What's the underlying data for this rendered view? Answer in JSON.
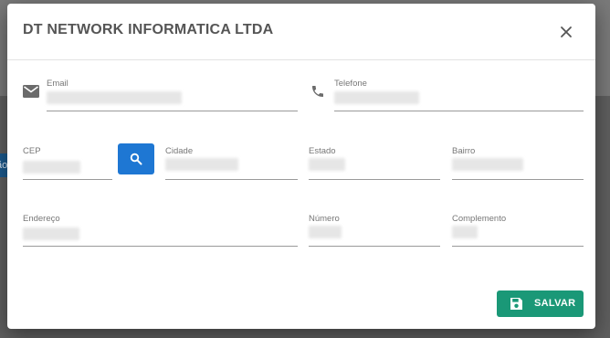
{
  "background": {
    "button_text": "ão"
  },
  "dialog": {
    "title": "DT NETWORK INFORMATICA LTDA",
    "close_icon": "close-icon"
  },
  "fields": {
    "email": {
      "label": "Email",
      "value": ""
    },
    "telefone": {
      "label": "Telefone",
      "value": ""
    },
    "cep": {
      "label": "CEP",
      "value": ""
    },
    "cidade": {
      "label": "Cidade",
      "value": ""
    },
    "estado": {
      "label": "Estado",
      "value": ""
    },
    "bairro": {
      "label": "Bairro",
      "value": ""
    },
    "endereco": {
      "label": "Endereço",
      "value": ""
    },
    "numero": {
      "label": "Número",
      "value": ""
    },
    "complemento": {
      "label": "Complemento",
      "value": ""
    }
  },
  "buttons": {
    "search_icon": "search-icon",
    "save_label": "SALVAR",
    "save_icon": "floppy-disk-icon"
  },
  "colors": {
    "primary": "#1e77d3",
    "save": "#1a9877"
  }
}
